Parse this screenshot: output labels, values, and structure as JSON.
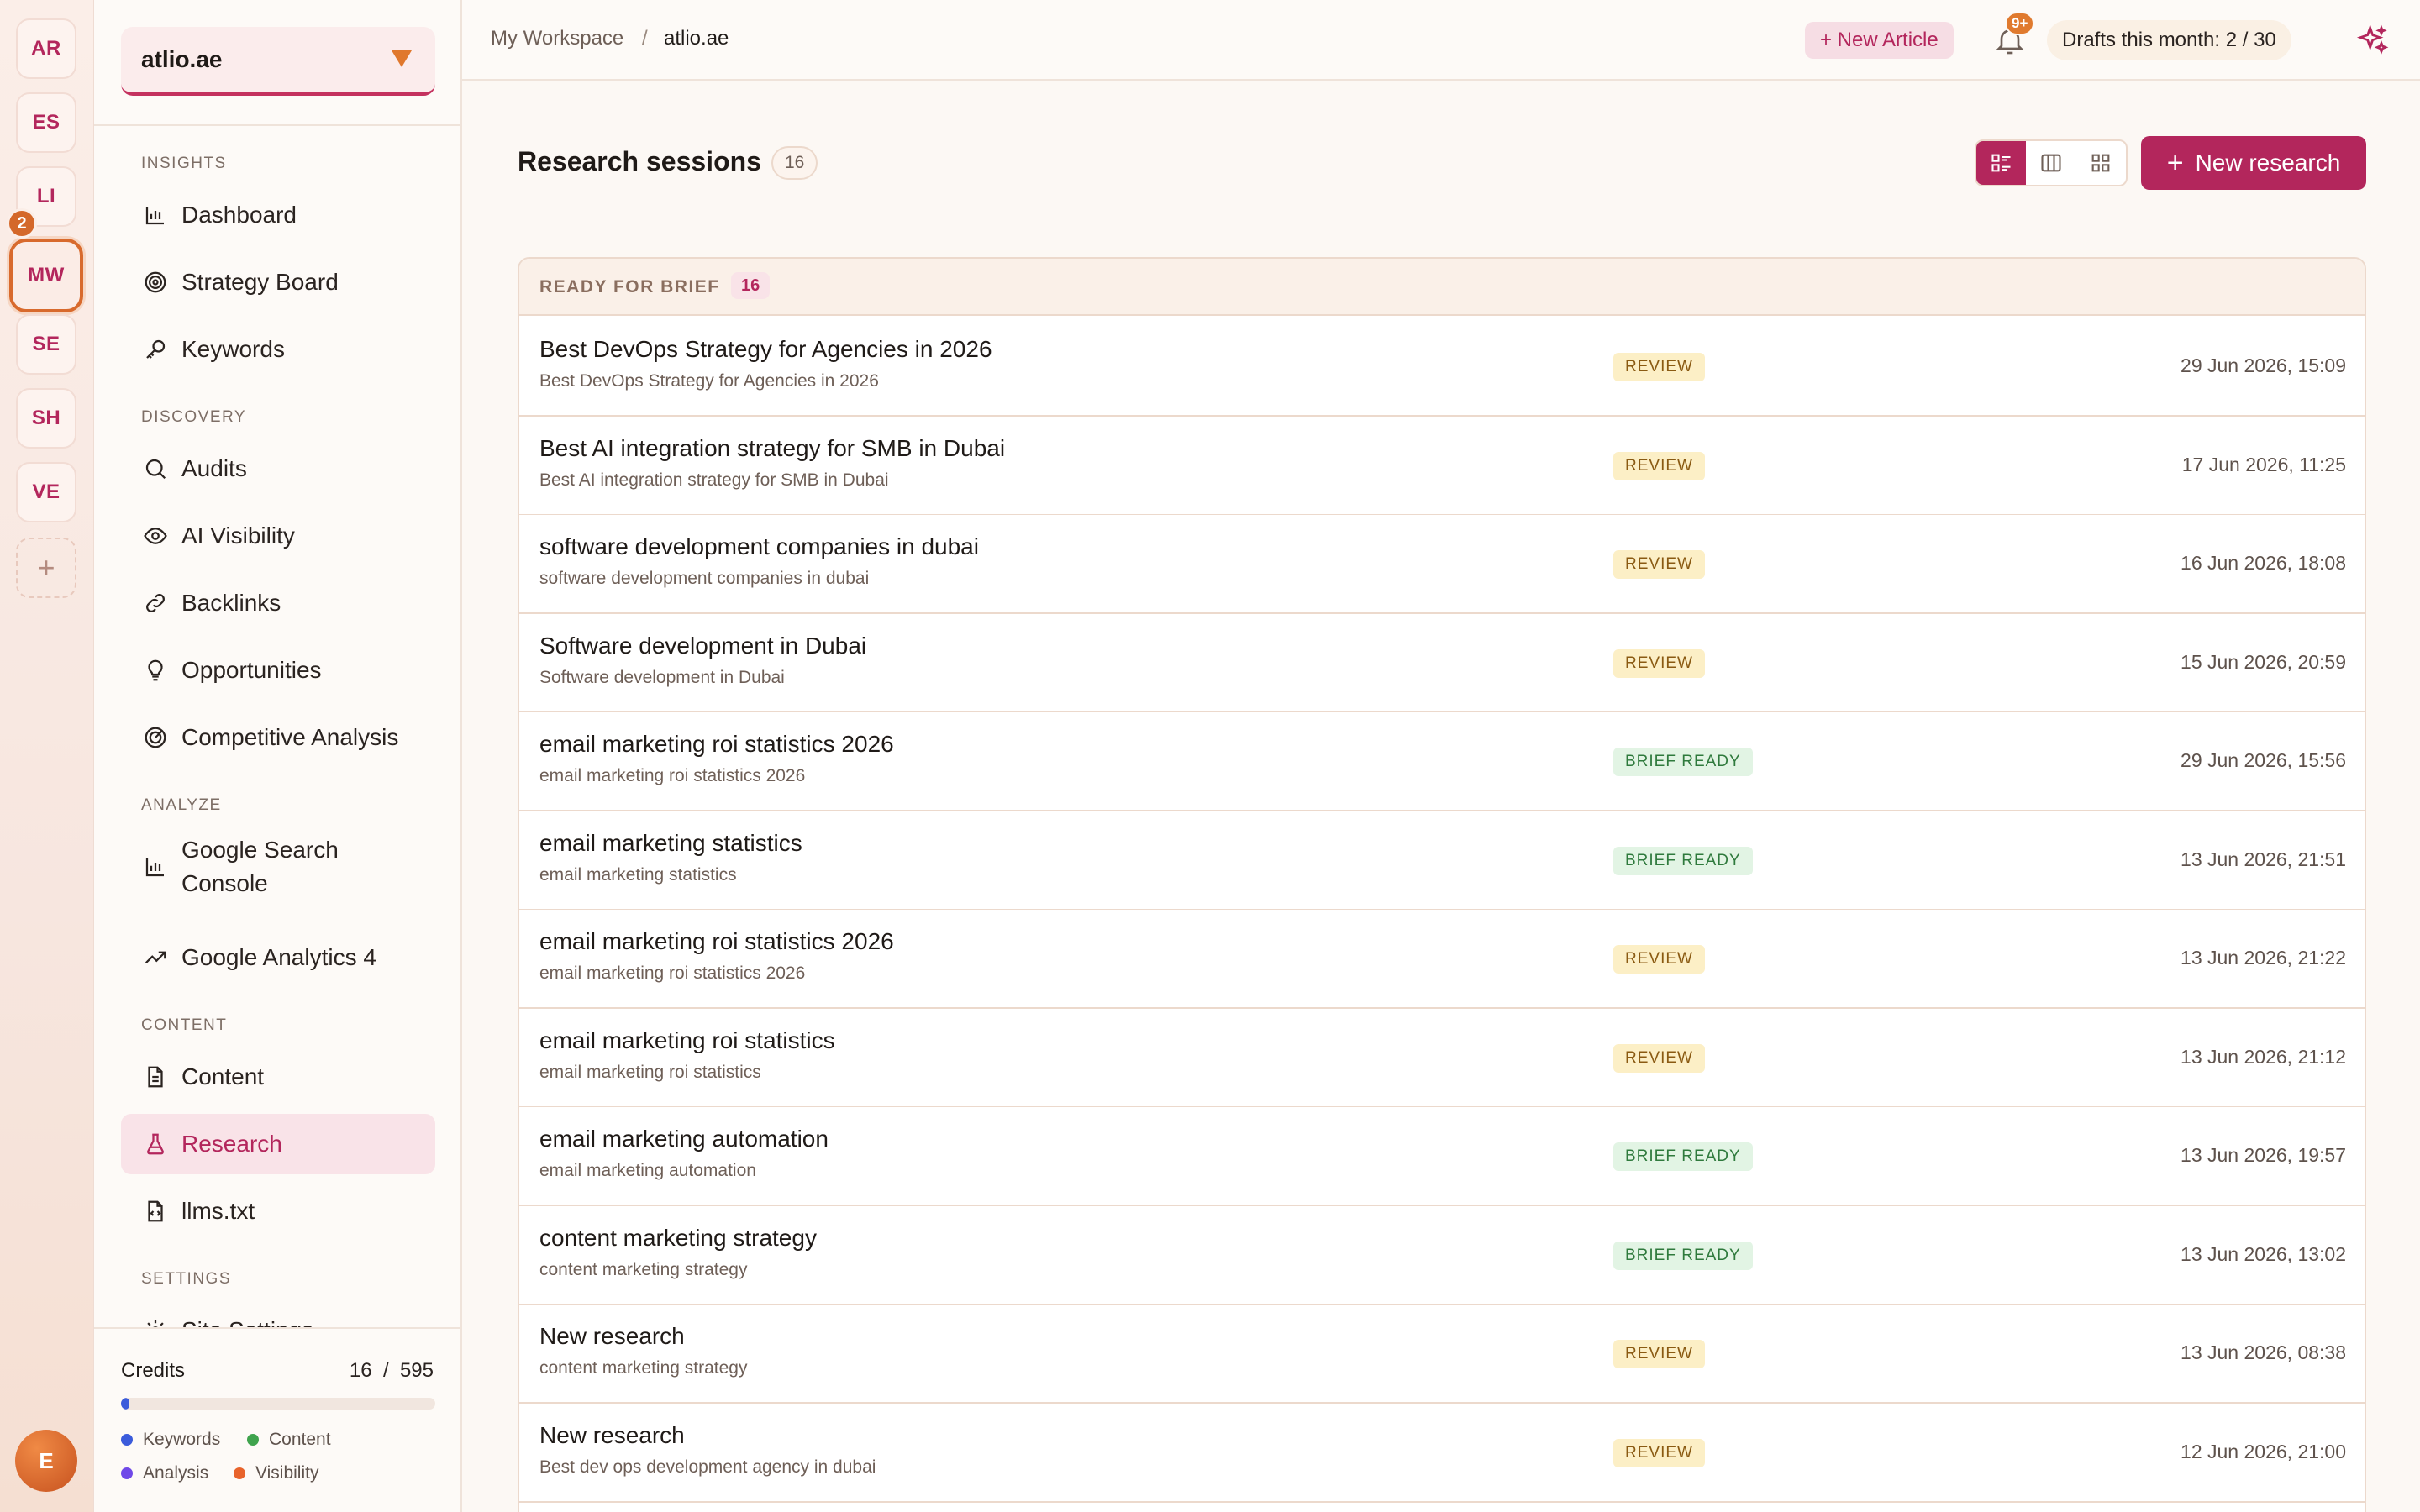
{
  "workspaces": {
    "items": [
      {
        "initials": "AR"
      },
      {
        "initials": "ES"
      },
      {
        "initials": "LI"
      },
      {
        "initials": "MW",
        "badge": "2",
        "active": true
      },
      {
        "initials": "SE"
      },
      {
        "initials": "SH"
      },
      {
        "initials": "VE"
      }
    ],
    "add_label": "+",
    "user_initial": "E"
  },
  "sidebar": {
    "site": "atlio.ae",
    "sections": {
      "insights": "INSIGHTS",
      "discovery": "DISCOVERY",
      "analyze": "ANALYZE",
      "content": "CONTENT",
      "settings": "SETTINGS"
    },
    "items": {
      "dashboard": "Dashboard",
      "strategy_board": "Strategy Board",
      "keywords": "Keywords",
      "audits": "Audits",
      "ai_visibility": "AI Visibility",
      "backlinks": "Backlinks",
      "opportunities": "Opportunities",
      "competitive_analysis": "Competitive Analysis",
      "google_search_console_1": "Google Search",
      "google_search_console_2": "Console",
      "google_analytics": "Google Analytics 4",
      "content": "Content",
      "research": "Research",
      "llms": "llms.txt",
      "site_settings": "Site Settings"
    },
    "credits": {
      "title": "Credits",
      "used": "16",
      "sep": "/",
      "total": "595",
      "fraction": 0.027,
      "legend": {
        "keywords": "Keywords",
        "content": "Content",
        "analysis": "Analysis",
        "visibility": "Visibility"
      },
      "colors": {
        "keywords": "#3b5bdb",
        "content": "#3fa34d",
        "analysis": "#7048e8",
        "visibility": "#e8632b"
      }
    }
  },
  "topbar": {
    "breadcrumb_root": "My Workspace",
    "breadcrumb_sep": "/",
    "breadcrumb_current": "atlio.ae",
    "new_article": "+ New Article",
    "notifications_badge": "9+",
    "drafts": "Drafts this month: 2 / 30"
  },
  "main": {
    "title": "Research sessions",
    "count": "16",
    "new_research": "New research",
    "new_research_plus": "+",
    "group": {
      "label": "READY FOR BRIEF",
      "count": "16"
    },
    "rows": [
      {
        "title": "Best DevOps Strategy for Agencies in 2026",
        "subtitle": "Best DevOps Strategy for Agencies in 2026",
        "status": "REVIEW",
        "date": "29 Jun 2026, 15:09"
      },
      {
        "title": "Best AI integration strategy for SMB in Dubai",
        "subtitle": "Best AI integration strategy for SMB in Dubai",
        "status": "REVIEW",
        "date": "17 Jun 2026, 11:25"
      },
      {
        "title": "software development companies in dubai",
        "subtitle": "software development companies in dubai",
        "status": "REVIEW",
        "date": "16 Jun 2026, 18:08"
      },
      {
        "title": "Software development in Dubai",
        "subtitle": "Software development in Dubai",
        "status": "REVIEW",
        "date": "15 Jun 2026, 20:59"
      },
      {
        "title": "email marketing roi statistics 2026",
        "subtitle": "email marketing roi statistics 2026",
        "status": "BRIEF READY",
        "date": "29 Jun 2026, 15:56"
      },
      {
        "title": "email marketing statistics",
        "subtitle": "email marketing statistics",
        "status": "BRIEF READY",
        "date": "13 Jun 2026, 21:51"
      },
      {
        "title": "email marketing roi statistics 2026",
        "subtitle": "email marketing roi statistics 2026",
        "status": "REVIEW",
        "date": "13 Jun 2026, 21:22"
      },
      {
        "title": "email marketing roi statistics",
        "subtitle": "email marketing roi statistics",
        "status": "REVIEW",
        "date": "13 Jun 2026, 21:12"
      },
      {
        "title": "email marketing automation",
        "subtitle": "email marketing automation",
        "status": "BRIEF READY",
        "date": "13 Jun 2026, 19:57"
      },
      {
        "title": "content marketing strategy",
        "subtitle": "content marketing strategy",
        "status": "BRIEF READY",
        "date": "13 Jun 2026, 13:02"
      },
      {
        "title": "New research",
        "subtitle": "content marketing strategy",
        "status": "REVIEW",
        "date": "13 Jun 2026, 08:38"
      },
      {
        "title": "New research",
        "subtitle": "Best dev ops development agency in dubai",
        "status": "REVIEW",
        "date": "12 Jun 2026, 21:00"
      }
    ]
  },
  "colors": {
    "accent": "#b3265c",
    "orange": "#e0782d",
    "review_bg": "#fcefc6",
    "brief_bg": "#e2f4e4"
  }
}
